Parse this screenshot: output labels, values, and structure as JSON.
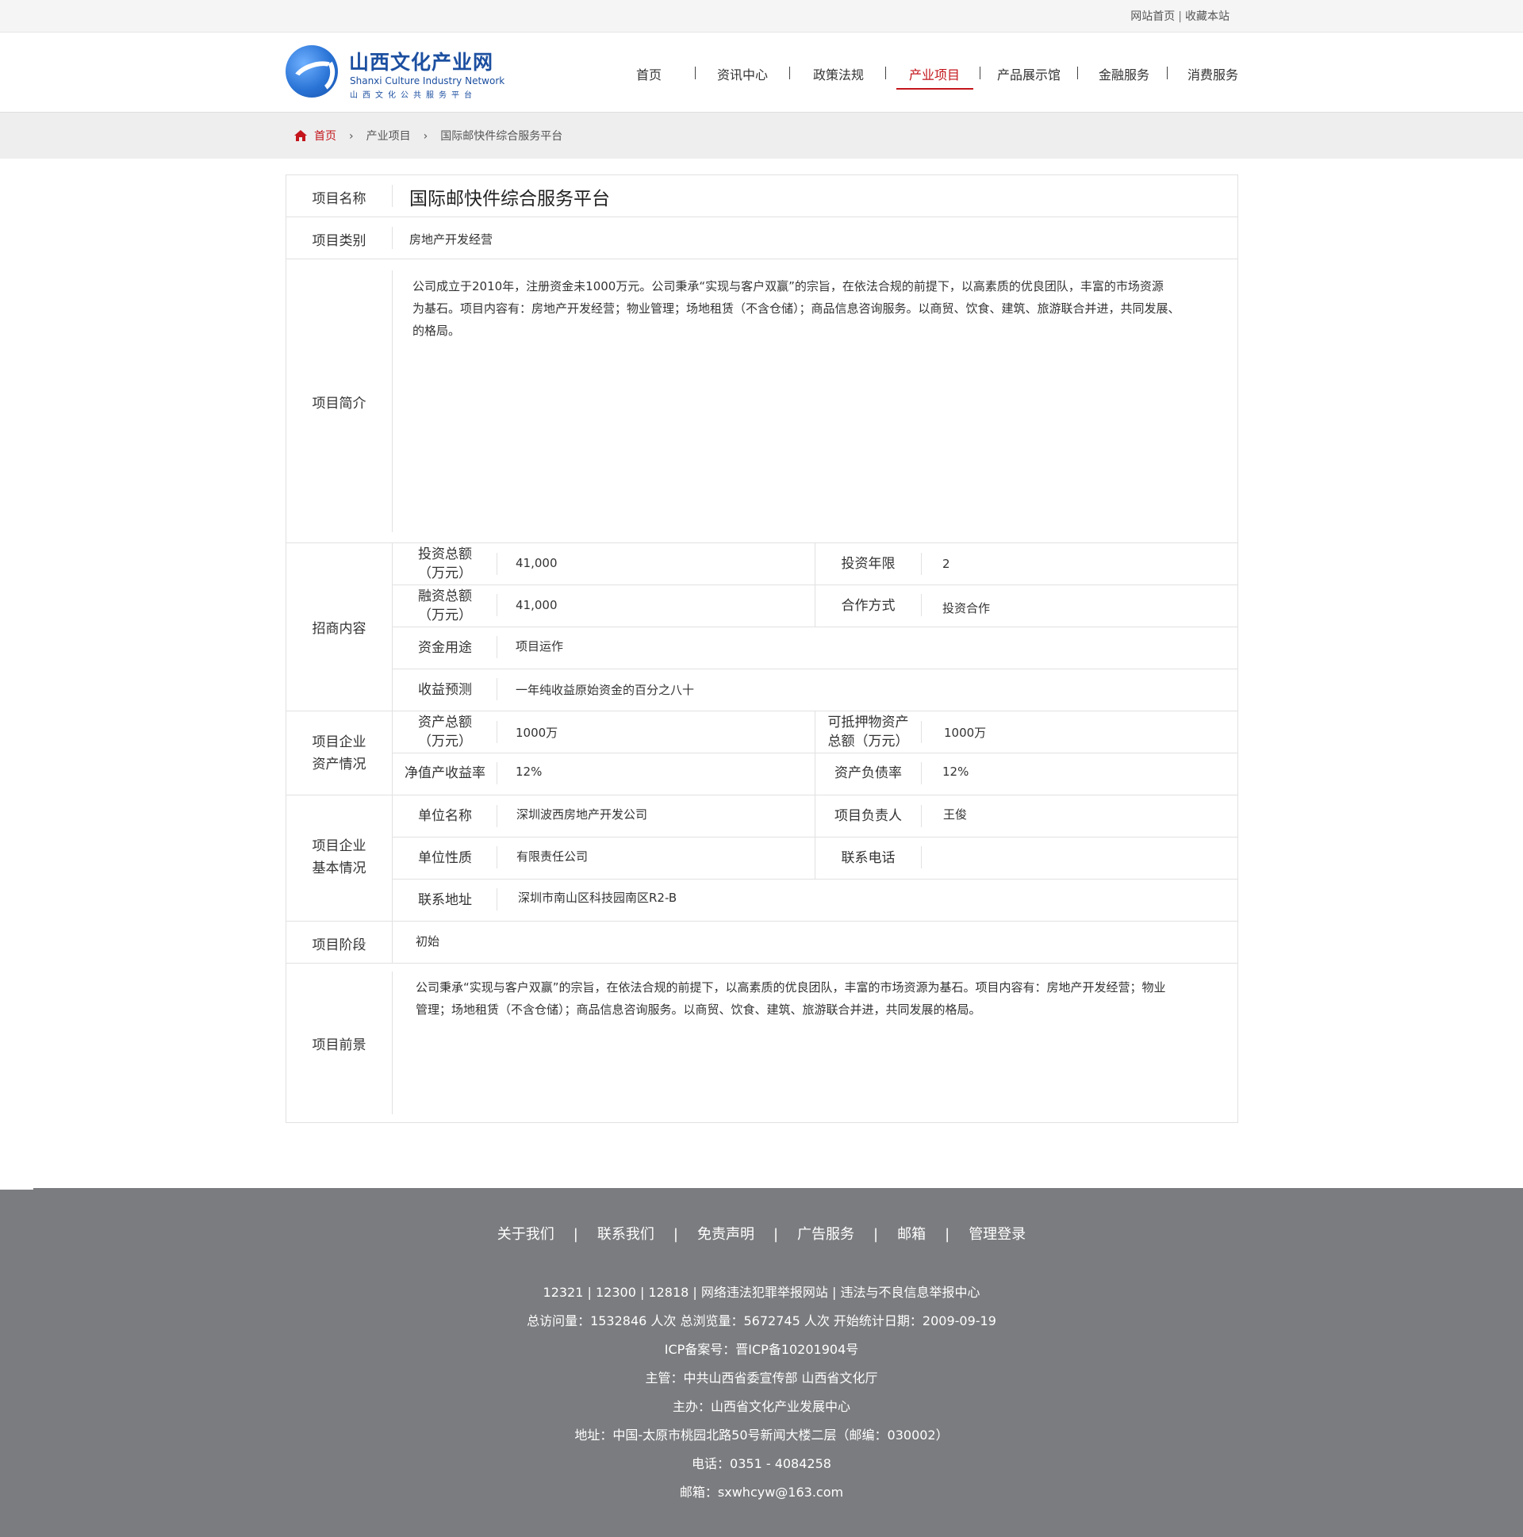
{
  "topbar": {
    "home_link": "网站首页",
    "separator": "|",
    "bookmark_link": "收藏本站"
  },
  "header": {
    "logo_cn": "山西文化产业网",
    "logo_en": "Shanxi Culture Industry Network",
    "logo_sub": "山西文化公共服务平台"
  },
  "nav": {
    "items": [
      "首页",
      "资讯中心",
      "政策法规",
      "产业项目",
      "产品展示馆",
      "金融服务",
      "消费服务"
    ],
    "active_index": 3,
    "active_color": "#c3151b"
  },
  "breadcrumb": {
    "icon": "home-icon",
    "home": "首页",
    "arrow": "›",
    "level1": "产业项目",
    "current": "国际邮快件综合服务平台"
  },
  "project": {
    "name_label": "项目名称",
    "name": "国际邮快件综合服务平台",
    "category_label": "项目类别",
    "category": "房地产开发经营",
    "intro_label": "项目简介",
    "intro_lines": [
      "公司成立于2010年，注册资金未1000万元。公司秉承“实现与客户双赢”的宗旨，在依法合规的前提下，以高素质的优良团队，丰富的市场资源",
      "为基石。项目内容有：房地产开发经营；物业管理；场地租赁（不含仓储）；商品信息咨询服务。以商贸、饮食、建筑、旅游联合并进，共同发展、",
      "的格局。"
    ],
    "investment": {
      "label": "招商内容",
      "total_label_1": "投资总额",
      "total_label_2": "（万元）",
      "total": "41,000",
      "term_label": "投资年限",
      "term": "2",
      "financing_label_1": "融资总额",
      "financing_label_2": "（万元）",
      "financing": "41,000",
      "coop_label": "合作方式",
      "coop": "投资合作",
      "use_label": "资金用途",
      "use": "项目运作",
      "return_label": "收益预测",
      "return": "一年纯收益原始资金的百分之八十"
    },
    "assets": {
      "label_1": "项目企业",
      "label_2": "资产情况",
      "total_label_1": "资产总额",
      "total_label_2": "（万元）",
      "total": "1000万",
      "collateral_label_1": "可抵押物资产",
      "collateral_label_2": "总额（万元）",
      "collateral": "1000万",
      "roe_label": "净值产收益率",
      "roe": "12%",
      "debt_label": "资产负债率",
      "debt": "12%"
    },
    "basic": {
      "label_1": "项目企业",
      "label_2": "基本情况",
      "unit_label": "单位名称",
      "unit": "深圳波西房地产开发公司",
      "manager_label": "项目负责人",
      "manager": "王俊",
      "nature_label": "单位性质",
      "nature": "有限责任公司",
      "phone_label": "联系电话",
      "phone": "",
      "address_label": "联系地址",
      "address": "深圳市南山区科技园南区R2-B"
    },
    "stage_label": "项目阶段",
    "stage": "初始",
    "prospect_label": "项目前景",
    "prospect_lines": [
      "公司秉承“实现与客户双赢”的宗旨，在依法合规的前提下，以高素质的优良团队，丰富的市场资源为基石。项目内容有：房地产开发经营；物业",
      "管理；场地租赁（不含仓储）；商品信息咨询服务。以商贸、饮食、建筑、旅游联合并进，共同发展的格局。"
    ]
  },
  "footer": {
    "nav": [
      "关于我们",
      "联系我们",
      "免责声明",
      "广告服务",
      "邮箱",
      "管理登录"
    ],
    "nav_separator": "|",
    "lines": [
      "12321 | 12300 | 12818 | 网络违法犯罪举报网站 | 违法与不良信息举报中心",
      "总访问量：1532846 人次  总浏览量：5672745 人次  开始统计日期：2009-09-19",
      "ICP备案号：晋ICP备10201904号",
      "主管：中共山西省委宣传部 山西省文化厅",
      "主办：山西省文化产业发展中心",
      "地址：中国-太原市桃园北路50号新闻大楼二层（邮编：030002）",
      "电话：0351 - 4084258",
      "邮箱：sxwhcyw@163.com"
    ],
    "background": "#7b7c7f"
  }
}
